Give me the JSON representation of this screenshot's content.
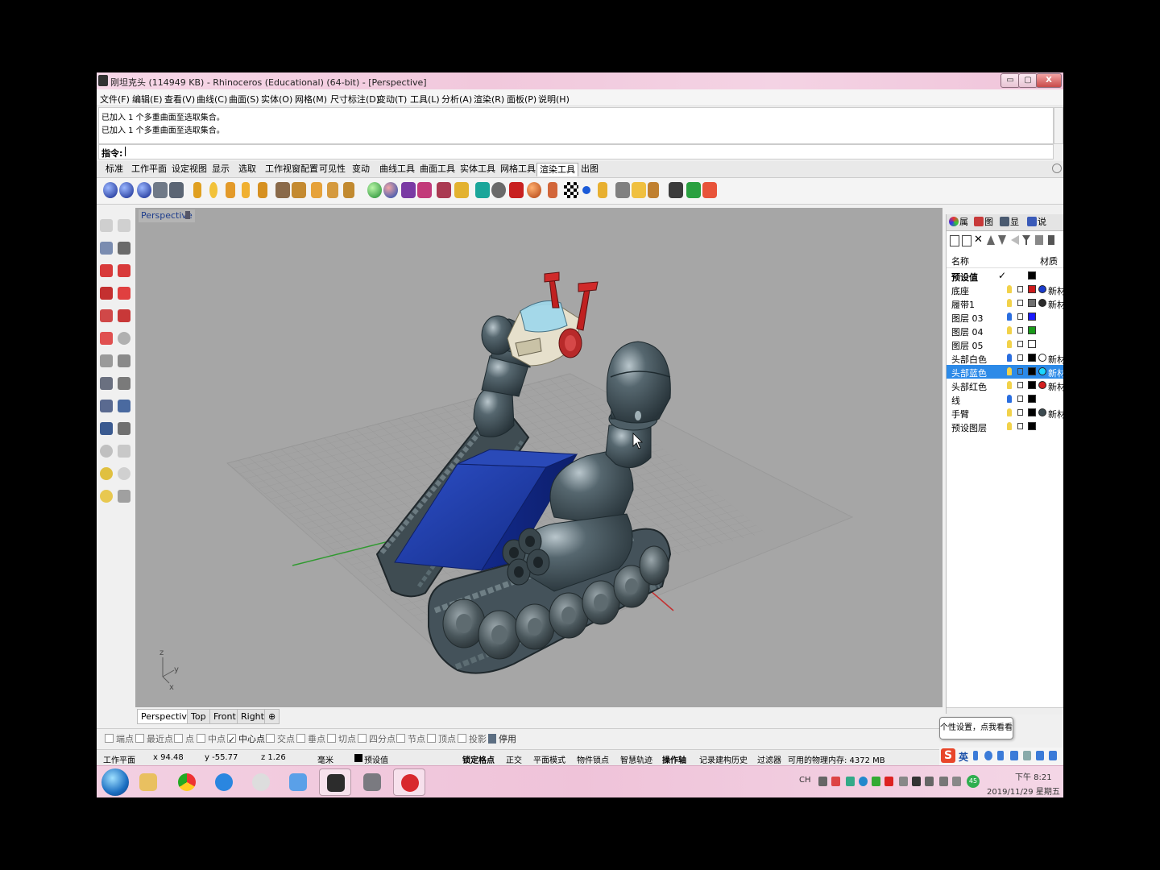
{
  "window": {
    "title": "刚坦克头 (114949 KB) - Rhinoceros (Educational) (64-bit) - [Perspective]",
    "min": "▭",
    "max": "▢",
    "close": "X"
  },
  "menu": [
    "文件(F)",
    "编辑(E)",
    "查看(V)",
    "曲线(C)",
    "曲面(S)",
    "实体(O)",
    "网格(M)",
    "尺寸标注(D)",
    "变动(T)",
    "工具(L)",
    "分析(A)",
    "渲染(R)",
    "面板(P)",
    "说明(H)"
  ],
  "command": {
    "history": [
      "已加入 1 个多重曲面至选取集合。",
      "已加入 1 个多重曲面至选取集合。"
    ],
    "prompt": "指令:"
  },
  "toolbar_tabs": [
    "标准",
    "工作平面",
    "设定视图",
    "显示",
    "选取",
    "工作视窗配置",
    "可见性",
    "变动",
    "曲线工具",
    "曲面工具",
    "实体工具",
    "网格工具",
    "渲染工具",
    "出图"
  ],
  "active_toolbar_tab": "渲染工具",
  "viewport": {
    "label": "Perspective",
    "axis_z": "z",
    "axis_y": "y",
    "axis_x": "x",
    "tabs": [
      "Perspective",
      "Top",
      "Front",
      "Right"
    ],
    "add_tab": "⊕"
  },
  "panel": {
    "tabs": [
      "属",
      "图",
      "显",
      "说"
    ],
    "col_name": "名称",
    "col_material": "材质",
    "layers": [
      {
        "name": "预设值",
        "bold": true,
        "check": "✓",
        "color": "#000000",
        "mat": ""
      },
      {
        "name": "底座",
        "color": "#cc1a1a",
        "mat": "新材",
        "mcolor": "#1a3ccc"
      },
      {
        "name": "履带1",
        "color": "#707070",
        "mat": "新材",
        "mcolor": "#2a2a2a"
      },
      {
        "name": "图层 03",
        "color": "#1a1aff",
        "mat": ""
      },
      {
        "name": "图层 04",
        "color": "#1a9a1a",
        "mat": ""
      },
      {
        "name": "图层 05",
        "color": "#ffffff",
        "mat": ""
      },
      {
        "name": "头部白色",
        "color": "#000000",
        "mat": "新材",
        "mcolor": "#ffffff"
      },
      {
        "name": "头部蓝色",
        "color": "#000000",
        "mat": "新材",
        "mcolor": "#19d7ff",
        "selected": true
      },
      {
        "name": "头部红色",
        "color": "#000000",
        "mat": "新材",
        "mcolor": "#d21f1f"
      },
      {
        "name": "线",
        "color": "#000000",
        "mat": ""
      },
      {
        "name": "手臂",
        "color": "#000000",
        "mat": "新材",
        "mcolor": "#3c4a50"
      },
      {
        "name": "预设图层",
        "color": "#000000",
        "mat": ""
      }
    ]
  },
  "osnap": [
    {
      "label": "端点",
      "on": false
    },
    {
      "label": "最近点",
      "on": false
    },
    {
      "label": "点",
      "on": false
    },
    {
      "label": "中点",
      "on": false
    },
    {
      "label": "中心点",
      "on": true
    },
    {
      "label": "交点",
      "on": false
    },
    {
      "label": "垂点",
      "on": false
    },
    {
      "label": "切点",
      "on": false
    },
    {
      "label": "四分点",
      "on": false
    },
    {
      "label": "节点",
      "on": false
    },
    {
      "label": "顶点",
      "on": false
    },
    {
      "label": "投影",
      "on": false
    }
  ],
  "osnap_disable": "停用",
  "status": {
    "cplane": "工作平面",
    "x": "x 94.48",
    "y": "y -55.77",
    "z": "z 1.26",
    "unit": "毫米",
    "layer": "预设值",
    "grid_snap": "锁定格点",
    "ortho": "正交",
    "planar": "平面模式",
    "osnap": "物件锁点",
    "smarttrack": "智慧轨迹",
    "gumball": "操作轴",
    "history": "记录建构历史",
    "filter": "过滤器",
    "memory": "可用的物理内存: 4372 MB"
  },
  "tooltip": "个性设置，点我看看",
  "ime": {
    "logo": "S",
    "lang": "英"
  },
  "taskbar": {
    "tray_lang": "CH",
    "badge": "45",
    "time": "下午 8:21",
    "date": "2019/11/29 星期五"
  },
  "colors": {
    "viewport_bg": "#a6a6a6",
    "selected_row": "#2c8ae8",
    "track": "#4a5e66",
    "chassis": "#1e3ea8"
  }
}
